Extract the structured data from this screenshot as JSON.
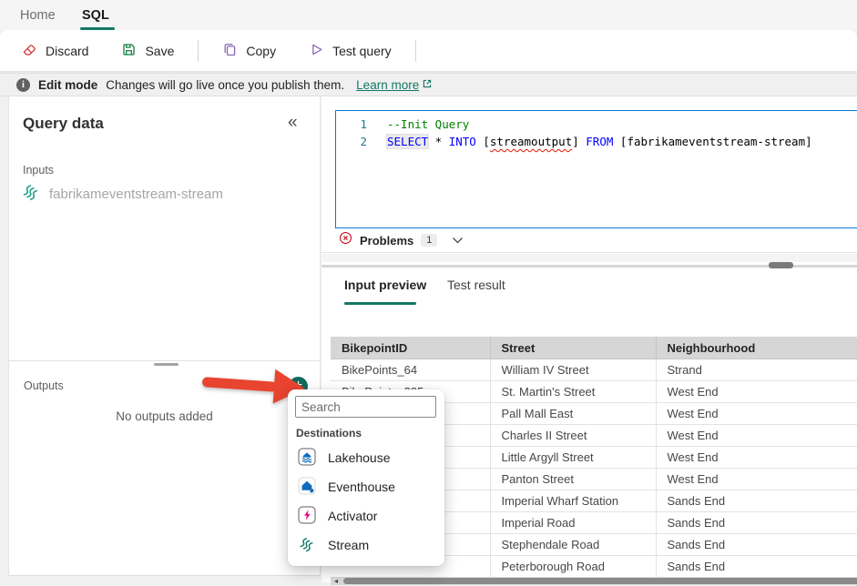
{
  "colors": {
    "accent_teal": "#117865",
    "add_button_green": "#0e6b5b",
    "arrow_red": "#e8442f",
    "editor_border_blue": "#0a7ad5",
    "error_red": "#c50f1f"
  },
  "tabs": {
    "home": "Home",
    "sql": "SQL"
  },
  "toolbar": {
    "discard": "Discard",
    "save": "Save",
    "copy": "Copy",
    "test_query": "Test query"
  },
  "banner": {
    "title": "Edit mode",
    "message": "Changes will go live once you publish them.",
    "link": "Learn more"
  },
  "left_panel": {
    "title": "Query data",
    "collapse_glyph": "«",
    "inputs_label": "Inputs",
    "input_item": "fabrikameventstream-stream",
    "outputs_label": "Outputs",
    "add_glyph": "+",
    "outputs_empty": "No outputs added"
  },
  "editor": {
    "lines": [
      {
        "num": "1",
        "tokens": [
          {
            "text": "--Init Query",
            "style": "comment"
          }
        ]
      },
      {
        "num": "2",
        "tokens": [
          {
            "text": "SELECT",
            "style": "kw-hl"
          },
          {
            "text": " * ",
            "style": "plain"
          },
          {
            "text": "INTO",
            "style": "kw"
          },
          {
            "text": " [",
            "style": "plain"
          },
          {
            "text": "streamoutput",
            "style": "error"
          },
          {
            "text": "] ",
            "style": "plain"
          },
          {
            "text": "FROM",
            "style": "kw"
          },
          {
            "text": " [fabrikameventstream-stream]",
            "style": "plain"
          }
        ]
      }
    ]
  },
  "problems": {
    "label": "Problems",
    "count": "1"
  },
  "preview": {
    "tab_active": "Input preview",
    "tab_inactive": "Test result"
  },
  "table": {
    "columns": [
      "BikepointID",
      "Street",
      "Neighbourhood"
    ],
    "rows": [
      [
        "BikePoints_64",
        "William IV Street",
        "Strand"
      ],
      [
        "BikePoints_335",
        "St. Martin's Street",
        "West End"
      ],
      [
        "",
        "Pall Mall East",
        "West End"
      ],
      [
        "",
        "Charles II Street",
        "West End"
      ],
      [
        "",
        "Little Argyll Street",
        "West End"
      ],
      [
        "",
        "Panton Street",
        "West End"
      ],
      [
        "",
        "Imperial Wharf Station",
        "Sands End"
      ],
      [
        "",
        "Imperial Road",
        "Sands End"
      ],
      [
        "",
        "Stephendale Road",
        "Sands End"
      ],
      [
        "",
        "Peterborough Road",
        "Sands End"
      ]
    ]
  },
  "scrollbar": {
    "left_arrow": "◂"
  },
  "dropdown": {
    "search_placeholder": "Search",
    "section_label": "Destinations",
    "items": [
      {
        "label": "Lakehouse",
        "icon": "lakehouse-icon"
      },
      {
        "label": "Eventhouse",
        "icon": "eventhouse-icon"
      },
      {
        "label": "Activator",
        "icon": "activator-icon"
      },
      {
        "label": "Stream",
        "icon": "stream-icon"
      }
    ]
  }
}
